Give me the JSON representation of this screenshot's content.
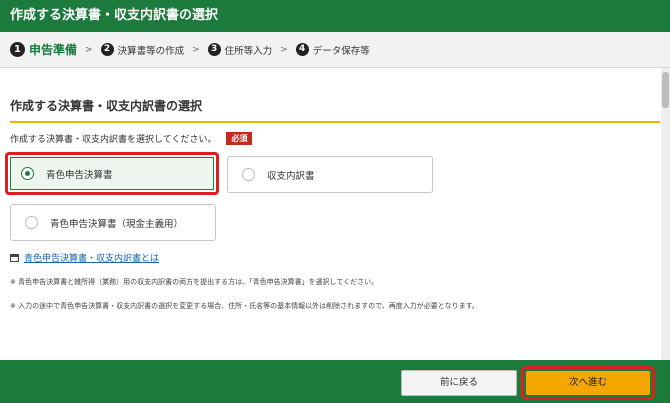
{
  "window": {
    "title": "作成する決算書・収支内訳書の選択"
  },
  "steps": [
    {
      "num": "1",
      "label": "申告準備"
    },
    {
      "num": "2",
      "label": "決算書等の作成"
    },
    {
      "num": "3",
      "label": "住所等入力"
    },
    {
      "num": "4",
      "label": "データ保存等"
    }
  ],
  "step_separator": ">",
  "section": {
    "title": "作成する決算書・収支内訳書の選択",
    "instruction": "作成する決算書・収支内訳書を選択してください。",
    "required_badge": "必須"
  },
  "options": [
    {
      "label": "青色申告決算書",
      "selected": true
    },
    {
      "label": "収支内訳書",
      "selected": false
    },
    {
      "label": "青色申告決算書（現金主義用）",
      "selected": false
    }
  ],
  "help_link": "青色申告決算書・収支内訳書とは",
  "notes": [
    "※ 青色申告決算書と雑所得（業務）用の収支内訳書の両方を提出する方は、「青色申告決算書」を選択してください。",
    "※ 入力の途中で青色申告決算書・収支内訳書の選択を変更する場合、住所・氏名等の基本情報以外は削除されますので、再度入力が必要となります。"
  ],
  "buttons": {
    "back": "前に戻る",
    "next": "次へ進む"
  },
  "colors": {
    "header_green": "#1b7a3c",
    "accent_yellow": "#f0b400",
    "next_orange": "#f3a700",
    "highlight_red": "#d82020"
  }
}
